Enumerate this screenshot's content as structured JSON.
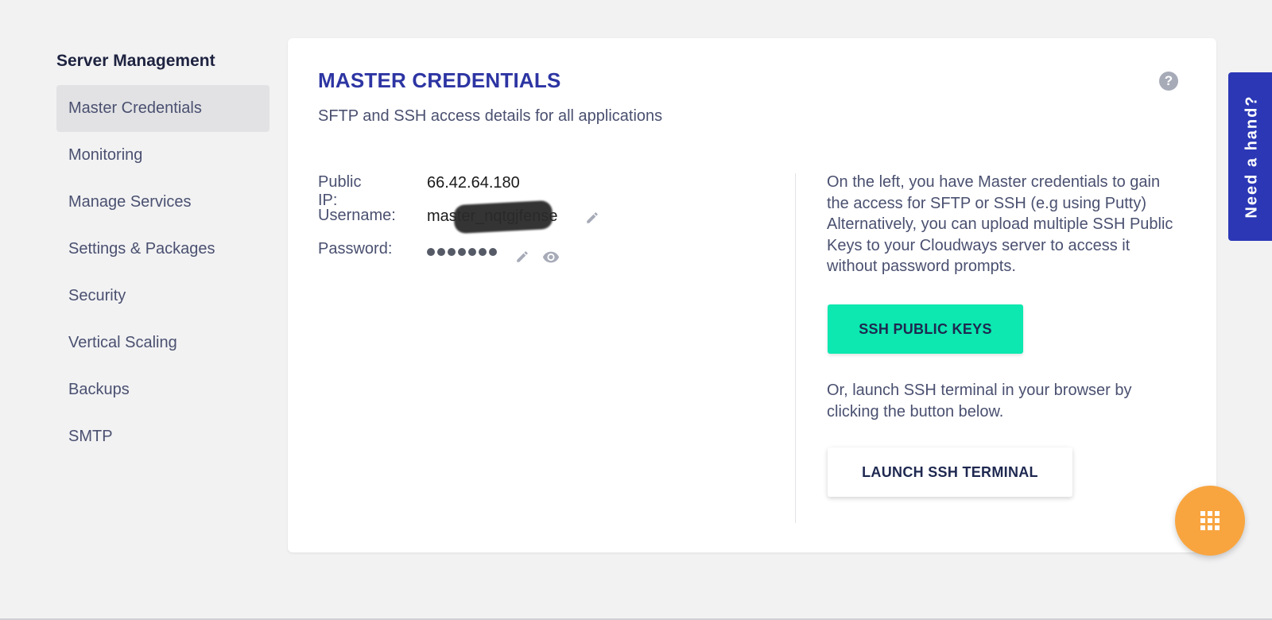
{
  "sidebar": {
    "title": "Server Management",
    "items": [
      {
        "label": "Master Credentials",
        "active": true
      },
      {
        "label": "Monitoring"
      },
      {
        "label": "Manage Services"
      },
      {
        "label": "Settings & Packages"
      },
      {
        "label": "Security"
      },
      {
        "label": "Vertical Scaling"
      },
      {
        "label": "Backups"
      },
      {
        "label": "SMTP"
      }
    ]
  },
  "card": {
    "title": "MASTER CREDENTIALS",
    "subtitle": "SFTP and SSH access details for all applications",
    "help_icon": "question-icon",
    "credentials": {
      "public_ip_label": "Public IP:",
      "public_ip_value": "66.42.64.180",
      "username_label": "Username:",
      "username_value": "master_nqtgjfense",
      "password_label": "Password:",
      "password_dots": 7
    },
    "info_text": "On the left, you have Master credentials to gain the access for SFTP or SSH (e.g using Putty) Alternatively, you can upload multiple SSH Public Keys to your Cloudways server to access it without password prompts.",
    "ssh_keys_button": "SSH PUBLIC KEYS",
    "or_text": "Or, launch SSH terminal in your browser by clicking the button below.",
    "launch_button": "LAUNCH SSH TERMINAL"
  },
  "help_tab": {
    "label": "Need a hand?"
  },
  "fab": {
    "icon": "grid-icon"
  },
  "colors": {
    "accent": "#2d35a3",
    "help_tab": "#2b37b5",
    "ssh_button": "#0ce8b0",
    "fab": "#f8a540",
    "active_item_bg": "#e2e2e4"
  }
}
